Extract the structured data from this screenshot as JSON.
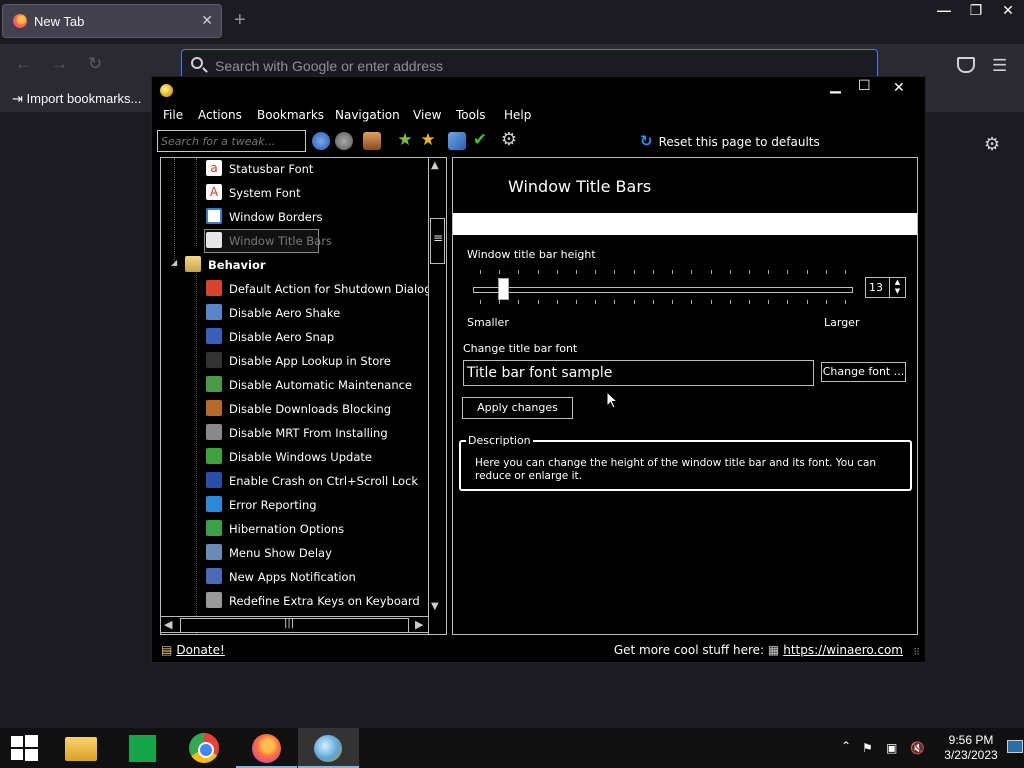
{
  "browser": {
    "tab_title": "New Tab",
    "tab_close": "✕",
    "new_tab": "+",
    "url_placeholder": "Search with Google or enter address",
    "bookmark_import": "Import bookmarks...",
    "back": "←",
    "forward": "→",
    "reload": "↻",
    "menu": "☰",
    "settings": "⚙",
    "window_buttons": {
      "minimize": "—",
      "maximize": "❐",
      "close": "✕"
    }
  },
  "winaero": {
    "window_buttons": {
      "minimize": "▁",
      "maximize": "☐",
      "close": "✕"
    },
    "menu": [
      "File",
      "Actions",
      "Bookmarks",
      "Navigation",
      "View",
      "Tools",
      "Help"
    ],
    "search_placeholder": "Search for a tweak...",
    "reset_icon": "↻",
    "reset_label": "Reset this page to defaults",
    "toolbar_icons": [
      "back-icon",
      "forward-icon",
      "home-icon",
      "add-bookmark-icon",
      "bookmarks-icon",
      "export-icon",
      "apply-icon",
      "settings-icon"
    ],
    "tree": {
      "items": [
        {
          "label": "Statusbar Font",
          "icon": "font-icon",
          "color": "#d23a2a"
        },
        {
          "label": "System Font",
          "icon": "font-icon",
          "color": "#d23a2a"
        },
        {
          "label": "Window Borders",
          "icon": "window-icon",
          "color": "#3a7bd5"
        },
        {
          "label": "Window Title Bars",
          "icon": "window-icon",
          "color": "#d8d8d8",
          "selected": true
        }
      ],
      "category": {
        "label": "Behavior",
        "icon": "folder-icon",
        "expander": "◢"
      },
      "behavior_items": [
        {
          "label": "Default Action for Shutdown Dialog",
          "icon": "shutdown-icon",
          "color": "#d8442b"
        },
        {
          "label": "Disable Aero Shake",
          "icon": "shake-icon",
          "color": "#5a86c9"
        },
        {
          "label": "Disable Aero Snap",
          "icon": "snap-icon",
          "color": "#3a5fb8"
        },
        {
          "label": "Disable App Lookup in Store",
          "icon": "store-icon",
          "color": "#333333"
        },
        {
          "label": "Disable Automatic Maintenance",
          "icon": "maintenance-icon",
          "color": "#4a9a4a"
        },
        {
          "label": "Disable Downloads Blocking",
          "icon": "downloads-icon",
          "color": "#b86a2b"
        },
        {
          "label": "Disable MRT From Installing",
          "icon": "mrt-icon",
          "color": "#8a8a8a"
        },
        {
          "label": "Disable Windows Update",
          "icon": "update-icon",
          "color": "#3fa23f"
        },
        {
          "label": "Enable Crash on Ctrl+Scroll Lock",
          "icon": "monitor-icon",
          "color": "#2b4fa8"
        },
        {
          "label": "Error Reporting",
          "icon": "flag-icon",
          "color": "#2b8ad8"
        },
        {
          "label": "Hibernation Options",
          "icon": "hibernate-icon",
          "color": "#3aa04a"
        },
        {
          "label": "Menu Show Delay",
          "icon": "menu-icon",
          "color": "#6a8ab8"
        },
        {
          "label": "New Apps Notification",
          "icon": "notification-icon",
          "color": "#4a6ab8"
        },
        {
          "label": "Redefine Extra Keys on Keyboard",
          "icon": "keyboard-icon",
          "color": "#9a9a9a"
        }
      ]
    },
    "scroll": {
      "up": "▲",
      "down": "▼",
      "left": "◀",
      "right": "▶",
      "grip": "≡",
      "hgrip": "|||"
    },
    "panel": {
      "title": "Window Title Bars",
      "height_label": "Window title bar height",
      "height_value": "13",
      "height_fraction": 0.05,
      "spin_up": "▲",
      "spin_down": "▼",
      "smaller": "Smaller",
      "larger": "Larger",
      "font_label": "Change title bar font",
      "font_sample": "Title bar font sample",
      "change_font": "Change font ...",
      "apply": "Apply changes",
      "description_title": "Description",
      "description": "Here you can change the height of the window title bar and its font. You can reduce or enlarge it."
    },
    "status": {
      "donate": "Donate!",
      "more_text": "Get more cool stuff here:",
      "more_link": "https://winaero.com",
      "grip": "⠿"
    }
  },
  "taskbar": {
    "apps": [
      "file-explorer",
      "microsoft-store",
      "chrome",
      "firefox",
      "winaero-tweaker"
    ],
    "tray_chevron": "⌃",
    "time": "9:56 PM",
    "date": "3/23/2023"
  }
}
